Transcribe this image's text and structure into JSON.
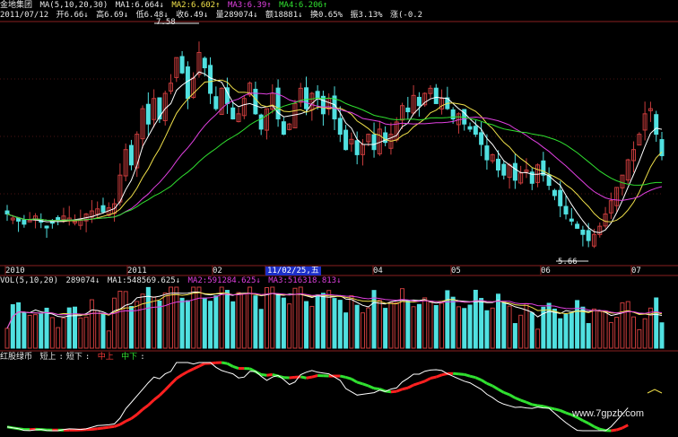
{
  "header": {
    "stock_name": "金地集团",
    "ma_params": "MA(5,10,20,30)",
    "ma1": "MA1:6.664↓",
    "ma2": "MA2:6.602↑",
    "ma3": "MA3:6.39↑",
    "ma4": "MA4:6.206↑"
  },
  "quote": {
    "date": "2011/07/12",
    "open": "开6.66↓",
    "high": "高6.69↓",
    "low": "低6.48↓",
    "close": "收6.49↓",
    "volume": "量289074↓",
    "amount": "额18881↓",
    "turnover": "换0.65%",
    "amplitude": "振3.13%",
    "change": "涨(-0.2"
  },
  "price_labels": {
    "high": "7.58",
    "low": "5.66"
  },
  "xaxis": {
    "ticks": [
      "2010",
      "2011",
      "02",
      "03",
      "04",
      "05",
      "06",
      "07"
    ],
    "cursor_date": "11/02/25,五"
  },
  "volume_header": {
    "params": "VOL(5,10,20)",
    "vol": "289074↓",
    "ma1": "MA1:548569.625↓",
    "ma2": "MA2:591284.625↓",
    "ma3": "MA3:516318.813↓"
  },
  "indicator_header": {
    "name": "红股绿币",
    "short_up": "短上",
    "short_down": "短下",
    "mid_up": "中上",
    "mid_down": "中下"
  },
  "watermark": "www.7gpzb.com",
  "colors": {
    "background": "#000000",
    "up_candle": "#c83c3c",
    "down_candle": "#50e0e0",
    "ma1": "#ffffff",
    "ma2": "#f0e04a",
    "ma3": "#e040e0",
    "ma4": "#30e030",
    "indicator_up": "#ff2020",
    "indicator_down": "#30e030",
    "date_cursor": "#1c2fc8"
  },
  "chart_data": {
    "type": "candlestick",
    "price_closes": [
      5.92,
      5.88,
      5.85,
      5.82,
      5.86,
      5.9,
      5.84,
      5.8,
      5.83,
      5.86,
      5.9,
      5.88,
      5.85,
      5.87,
      5.92,
      5.95,
      5.97,
      5.94,
      5.98,
      6.02,
      6.3,
      6.55,
      6.4,
      6.7,
      6.95,
      6.8,
      7.05,
      6.85,
      7.1,
      7.2,
      7.45,
      7.3,
      7.05,
      7.25,
      7.5,
      7.35,
      7.1,
      6.95,
      7.15,
      7.0,
      6.85,
      6.9,
      7.05,
      7.2,
      6.9,
      6.75,
      6.95,
      7.1,
      6.85,
      6.7,
      6.8,
      7.0,
      7.15,
      6.95,
      7.1,
      7.05,
      6.9,
      7.05,
      6.85,
      6.7,
      6.55,
      6.65,
      6.5,
      6.6,
      6.7,
      6.55,
      6.75,
      6.62,
      6.7,
      6.82,
      6.98,
      6.92,
      7.08,
      6.98,
      7.1,
      7.15,
      7.0,
      7.05,
      6.95,
      6.85,
      6.9,
      6.8,
      6.75,
      6.7,
      6.6,
      6.45,
      6.5,
      6.35,
      6.3,
      6.4,
      6.25,
      6.32,
      6.35,
      6.22,
      6.4,
      6.3,
      6.2,
      6.1,
      6.0,
      5.92,
      5.85,
      5.78,
      5.72,
      5.66,
      5.72,
      5.8,
      5.92,
      6.05,
      6.18,
      6.3,
      6.45,
      6.55,
      6.7,
      6.9,
      6.95,
      6.7,
      6.49
    ]
  }
}
